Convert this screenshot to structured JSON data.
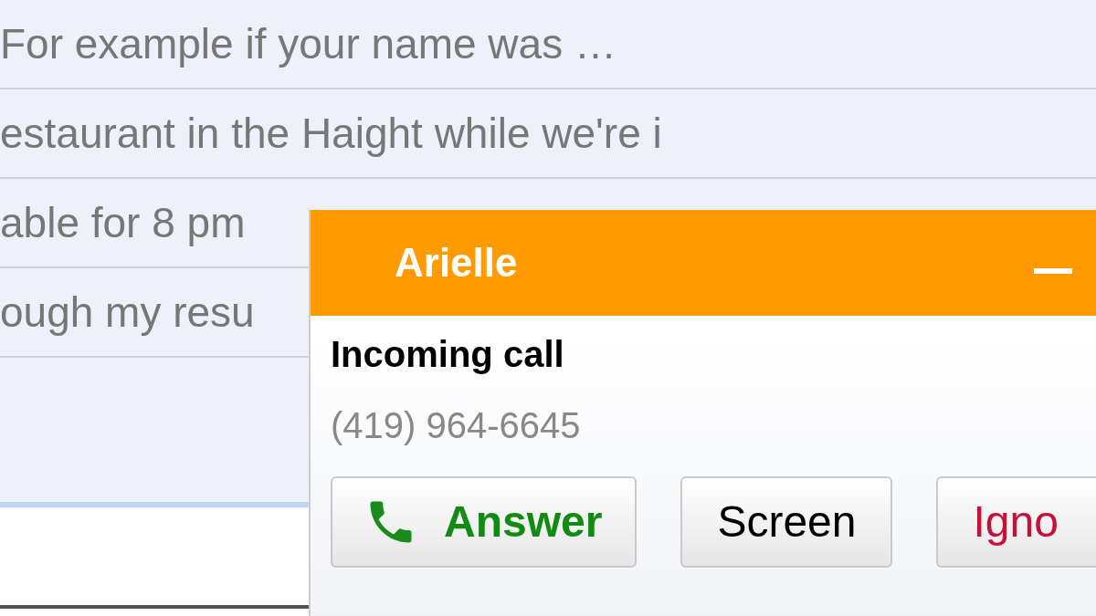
{
  "messages": [
    {
      "snippet": "For example if your name was …"
    },
    {
      "snippet": "estaurant in the Haight while we're i"
    },
    {
      "snippet": "able for 8 pm"
    },
    {
      "snippet": "ough my resu"
    }
  ],
  "call_popup": {
    "caller": "Arielle",
    "status": "Incoming call",
    "number": "(419) 964-6645",
    "buttons": [
      {
        "label": "Answer",
        "kind": "answer"
      },
      {
        "label": "Screen",
        "kind": "screen"
      },
      {
        "label": "Igno",
        "kind": "ignore"
      }
    ]
  }
}
